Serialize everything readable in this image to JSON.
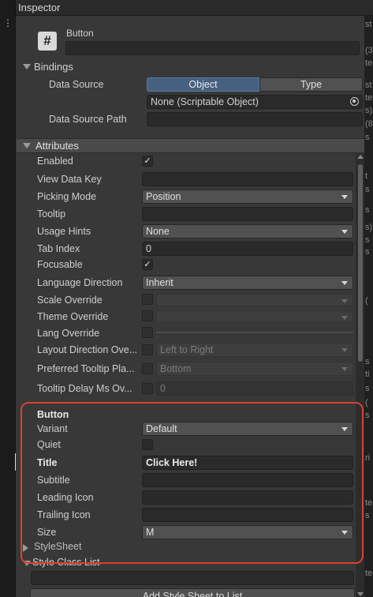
{
  "window": {
    "title": "Inspector"
  },
  "header": {
    "icon_glyph": "#",
    "element_name": "Button"
  },
  "bindings": {
    "label": "Bindings",
    "data_source_label": "Data Source",
    "segments": [
      "Object",
      "Type"
    ],
    "selected_segment": "Object",
    "object_value": "None (Scriptable Object)",
    "data_source_path_label": "Data Source Path",
    "data_source_path_value": ""
  },
  "attributes": {
    "label": "Attributes",
    "enabled": {
      "label": "Enabled",
      "checked": true
    },
    "view_data_key": {
      "label": "View Data Key",
      "value": ""
    },
    "picking_mode": {
      "label": "Picking Mode",
      "value": "Position"
    },
    "tooltip": {
      "label": "Tooltip",
      "value": ""
    },
    "usage_hints": {
      "label": "Usage Hints",
      "value": "None"
    },
    "tab_index": {
      "label": "Tab Index",
      "value": "0"
    },
    "focusable": {
      "label": "Focusable",
      "checked": true
    },
    "language_direction": {
      "label": "Language Direction",
      "value": "Inherit"
    },
    "scale_override": {
      "label": "Scale Override"
    },
    "theme_override": {
      "label": "Theme Override"
    },
    "lang_override": {
      "label": "Lang Override"
    },
    "layout_direction_override": {
      "label": "Layout Direction Ove...",
      "value": "Left to Right"
    },
    "preferred_tooltip_placement": {
      "label": "Preferred Tooltip Pla...",
      "value": "Bottom"
    },
    "tooltip_delay": {
      "label": "Tooltip Delay Ms Ov...",
      "value": "0"
    }
  },
  "button_section": {
    "heading": "Button",
    "variant": {
      "label": "Variant",
      "value": "Default"
    },
    "quiet": {
      "label": "Quiet",
      "checked": false
    },
    "title": {
      "label": "Title",
      "value": "Click Here!"
    },
    "subtitle": {
      "label": "Subtitle",
      "value": ""
    },
    "leading_icon": {
      "label": "Leading Icon",
      "value": ""
    },
    "trailing_icon": {
      "label": "Trailing Icon",
      "value": ""
    },
    "size": {
      "label": "Size",
      "value": "M"
    }
  },
  "stylesheet": {
    "label": "StyleSheet"
  },
  "style_class_list": {
    "label": "Style Class List",
    "value": "",
    "add_button_label": "Add Style Sheet to List"
  },
  "overflow_fragments": [
    "st",
    "(3",
    "te",
    "st",
    "te",
    "s)",
    "(8",
    "s",
    "t",
    "s",
    "s",
    "s)",
    "s",
    "s",
    "(",
    "s",
    "ti",
    "s",
    "(",
    "s",
    "ri",
    "te",
    "s",
    "te"
  ],
  "colors": {
    "highlight": "#d4432f",
    "segment_selected": "#46607f"
  }
}
